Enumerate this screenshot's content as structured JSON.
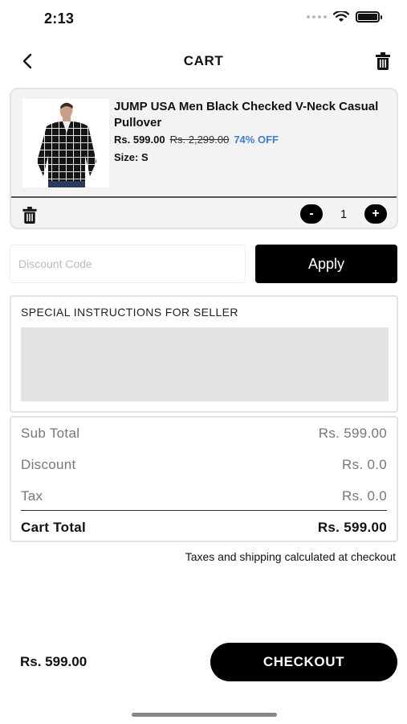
{
  "status": {
    "time": "2:13"
  },
  "nav": {
    "title": "CART",
    "back_icon": "chevron-left-icon",
    "trash_icon": "trash-icon"
  },
  "product": {
    "name": "JUMP USA Men Black Checked V-Neck Casual Pullover",
    "price": "Rs. 599.00",
    "old_price": "Rs. 2,299.00",
    "discount": "74% OFF",
    "size": "Size: S",
    "quantity": "1",
    "minus_label": "-",
    "plus_label": "+"
  },
  "discount_code": {
    "placeholder": "Discount Code",
    "value": "",
    "apply_label": "Apply"
  },
  "instructions": {
    "label": "SPECIAL INSTRUCTIONS FOR SELLER",
    "value": ""
  },
  "totals": {
    "subtotal_label": "Sub Total",
    "subtotal_value": "Rs. 599.00",
    "discount_label": "Discount",
    "discount_value": "Rs. 0.0",
    "tax_label": "Tax",
    "tax_value": "Rs. 0.0",
    "cart_total_label": "Cart Total",
    "cart_total_value": "Rs. 599.00"
  },
  "taxes_note": "Taxes and shipping calculated at checkout",
  "footer": {
    "total": "Rs. 599.00",
    "checkout_label": "CHECKOUT"
  },
  "colors": {
    "accent": "#000000",
    "discount_blue": "#3a7fd0",
    "card_bg": "#f3f3f3"
  }
}
